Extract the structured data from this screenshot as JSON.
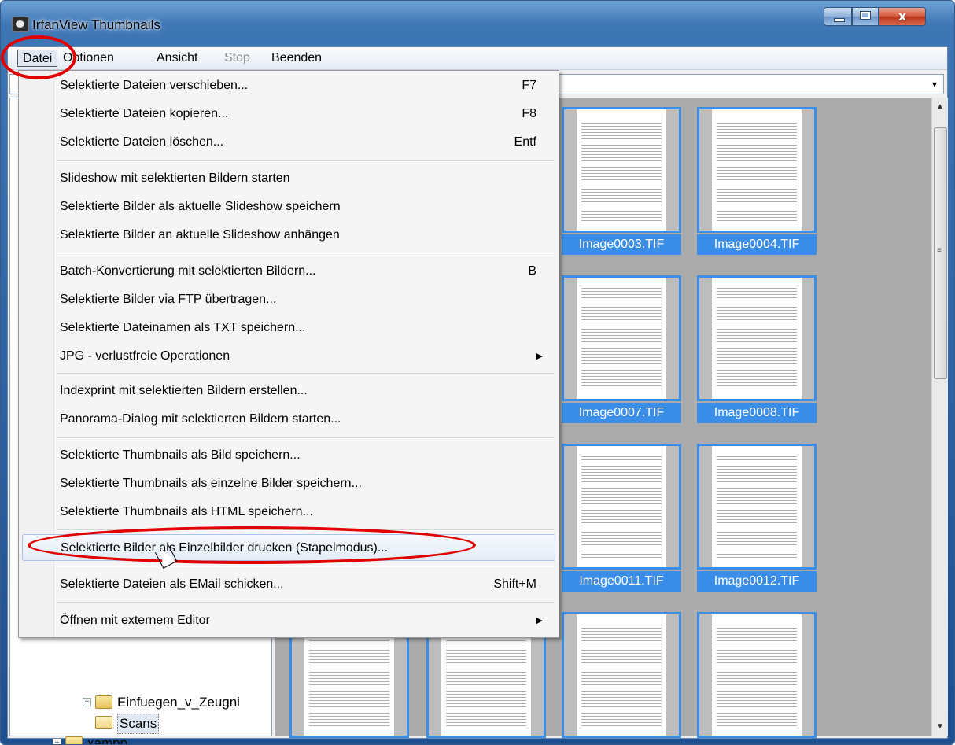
{
  "window": {
    "title": "IrfanView Thumbnails",
    "min_icon": "minimize-icon",
    "max_icon": "maximize-icon",
    "close_label": "x"
  },
  "menubar": {
    "file": "Datei",
    "options": "Optionen",
    "view": "Ansicht",
    "stop": "Stop",
    "quit": "Beenden"
  },
  "pathbar": {
    "dropdown_icon": "▾"
  },
  "dropdown": {
    "groups": [
      [
        {
          "label": "Selektierte Dateien verschieben...",
          "key": "F7"
        },
        {
          "label": "Selektierte Dateien kopieren...",
          "key": "F8"
        },
        {
          "label": "Selektierte Dateien löschen...",
          "key": "Entf"
        }
      ],
      [
        {
          "label": "Slideshow mit selektierten Bildern starten",
          "key": ""
        },
        {
          "label": "Selektierte Bilder als aktuelle Slideshow speichern",
          "key": ""
        },
        {
          "label": "Selektierte Bilder an aktuelle Slideshow anhängen",
          "key": ""
        }
      ],
      [
        {
          "label": "Batch-Konvertierung mit selektierten Bildern...",
          "key": "B"
        },
        {
          "label": "Selektierte Bilder via FTP übertragen...",
          "key": ""
        },
        {
          "label": "Selektierte Dateinamen als TXT speichern...",
          "key": ""
        },
        {
          "label": "JPG - verlustfreie Operationen",
          "key": "",
          "submenu": "▶"
        }
      ],
      [
        {
          "label": "Indexprint mit selektierten Bildern erstellen...",
          "key": ""
        },
        {
          "label": "Panorama-Dialog mit selektierten Bildern starten...",
          "key": ""
        }
      ],
      [
        {
          "label": "Selektierte Thumbnails als Bild speichern...",
          "key": ""
        },
        {
          "label": "Selektierte Thumbnails als einzelne Bilder speichern...",
          "key": ""
        },
        {
          "label": "Selektierte Thumbnails als HTML speichern...",
          "key": ""
        }
      ],
      [
        {
          "label": "Selektierte Bilder als Einzelbilder drucken (Stapelmodus)...",
          "key": "",
          "highlighted": true
        }
      ],
      [
        {
          "label": "Selektierte Dateien als EMail schicken...",
          "key": "Shift+M"
        }
      ],
      [
        {
          "label": "Öffnen mit externem Editor",
          "key": "",
          "submenu": "▶"
        }
      ]
    ]
  },
  "tree": {
    "items": [
      {
        "label": "Einfuegen_v_Zeugni",
        "expandable": "+"
      },
      {
        "label": "Scans",
        "selected": true
      },
      {
        "label": "xampp",
        "expandable": "+"
      }
    ],
    "scroll_grip": "III",
    "left_arrow": "◀",
    "right_arrow": "▶",
    "down_arrow": "▼"
  },
  "thumbnails": [
    {
      "caption": "Image0003.TIF"
    },
    {
      "caption": "Image0004.TIF"
    },
    {
      "caption": "Image0007.TIF"
    },
    {
      "caption": "Image0008.TIF"
    },
    {
      "caption": "Image0011.TIF"
    },
    {
      "caption": "Image0012.TIF"
    },
    {
      "caption": ""
    },
    {
      "caption": ""
    },
    {
      "caption": ""
    },
    {
      "caption": ""
    }
  ],
  "scrollbar": {
    "up_arrow": "▲",
    "down_arrow": "▼",
    "grip": "≡"
  },
  "colors": {
    "selection": "#3b8ee8",
    "highlight_ring": "#e00000",
    "thumb_bg": "#ababab"
  }
}
